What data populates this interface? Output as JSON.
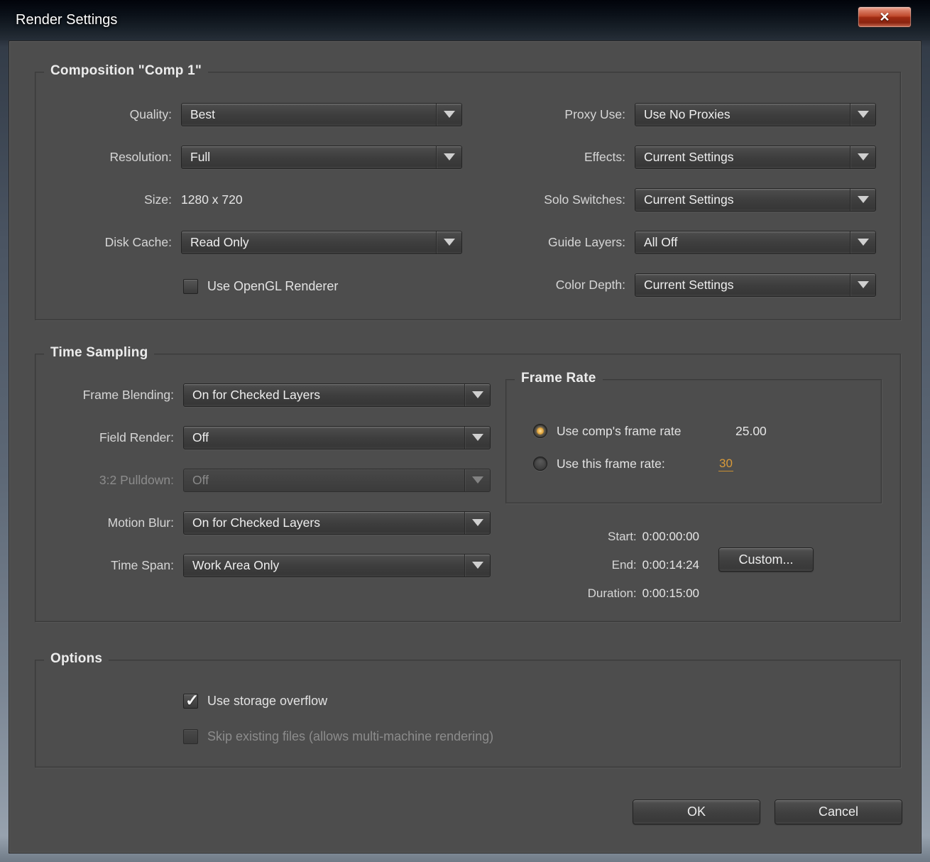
{
  "window": {
    "title": "Render Settings",
    "close_glyph": "✕"
  },
  "composition": {
    "legend": "Composition \"Comp 1\"",
    "quality_label": "Quality:",
    "quality_value": "Best",
    "resolution_label": "Resolution:",
    "resolution_value": "Full",
    "size_label": "Size:",
    "size_value": "1280 x 720",
    "disk_cache_label": "Disk Cache:",
    "disk_cache_value": "Read Only",
    "opengl_label": "Use OpenGL Renderer",
    "opengl_checked": false,
    "proxy_label": "Proxy Use:",
    "proxy_value": "Use No Proxies",
    "effects_label": "Effects:",
    "effects_value": "Current Settings",
    "solo_label": "Solo Switches:",
    "solo_value": "Current Settings",
    "guide_label": "Guide Layers:",
    "guide_value": "All Off",
    "color_depth_label": "Color Depth:",
    "color_depth_value": "Current Settings"
  },
  "time_sampling": {
    "legend": "Time Sampling",
    "frame_blending_label": "Frame Blending:",
    "frame_blending_value": "On for Checked Layers",
    "field_render_label": "Field Render:",
    "field_render_value": "Off",
    "pulldown_label": "3:2 Pulldown:",
    "pulldown_value": "Off",
    "pulldown_enabled": false,
    "motion_blur_label": "Motion Blur:",
    "motion_blur_value": "On for Checked Layers",
    "time_span_label": "Time Span:",
    "time_span_value": "Work Area Only"
  },
  "frame_rate": {
    "legend": "Frame Rate",
    "comp_rate_label": "Use comp's frame rate",
    "comp_rate_value": "25.00",
    "comp_rate_selected": true,
    "this_rate_label": "Use this frame rate:",
    "this_rate_value": "30",
    "this_rate_selected": false
  },
  "time_info": {
    "start_label": "Start:",
    "start_value": "0:00:00:00",
    "end_label": "End:",
    "end_value": "0:00:14:24",
    "duration_label": "Duration:",
    "duration_value": "0:00:15:00",
    "custom_button": "Custom..."
  },
  "options": {
    "legend": "Options",
    "storage_label": "Use storage overflow",
    "storage_checked": true,
    "skip_label": "Skip existing files (allows multi-machine rendering)",
    "skip_enabled": false
  },
  "footer": {
    "ok": "OK",
    "cancel": "Cancel"
  },
  "colors": {
    "dialog_bg": "#4d4d4d",
    "accent_orange": "#d89a3a"
  }
}
